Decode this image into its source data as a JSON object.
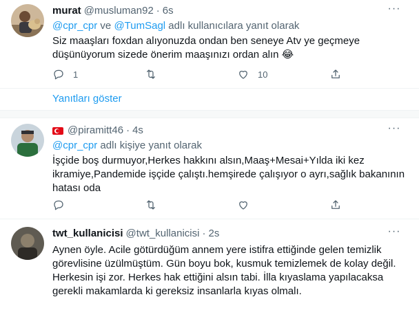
{
  "tweets": [
    {
      "name": "murat",
      "handle": "@musluman92",
      "dot": "·",
      "time": "6s",
      "replying": {
        "prefix": "",
        "mention1": "@cpr_cpr",
        "joiner": " ve ",
        "mention2": "@TumSagl",
        "suffix": " adlı kullanıcılara yanıt olarak"
      },
      "lines": [
        "Siz maaşları foxdan alıyonuzda ondan ben seneye Atv ye geçmeye",
        "düşünüyorum sizede önerim maaşınızı ordan alın 😂"
      ],
      "reply_count": "1",
      "retweet_count": "",
      "like_count": "10"
    },
    {
      "name": "",
      "handle": "@piramitt46",
      "dot": "·",
      "time": "4s",
      "replying": {
        "mention1": "@cpr_cpr",
        "suffix": " adlı kişiye yanıt olarak"
      },
      "lines": [
        "İşçide boş durmuyor,Herkes hakkını alsın,Maaş+Mesai+Yılda iki kez",
        "ikramiye,Pandemide işçide çalıştı.hemşirede çalışıyor o ayrı,sağlık bakanının",
        "hatası oda"
      ],
      "reply_count": "",
      "retweet_count": "",
      "like_count": ""
    },
    {
      "name": "twt_kullanicisi",
      "handle": "@twt_kullanicisi",
      "dot": "·",
      "time": "2s",
      "lines": [
        "Aynen öyle. Acile götürdüğüm annem yere istifra ettiğinde gelen temizlik",
        "görevlisine üzülmüştüm. Gün boyu bok, kusmuk temizlemek de kolay değil.",
        "Herkesin işi zor. Herkes hak ettiğini alsın tabi. İlla kıyaslama yapılacaksa",
        "gerekli makamlarda ki gereksiz insanlarla kıyas olmalı."
      ]
    }
  ],
  "show_replies": "Yanıtları göster",
  "more_glyph": "···",
  "colors": {
    "accent": "#1d9bf0",
    "secondary_text": "#536471",
    "divider": "#eff3f4"
  },
  "icons": [
    "reply-icon",
    "retweet-icon",
    "like-icon",
    "share-icon",
    "more-icon",
    "turkey-flag-icon"
  ]
}
